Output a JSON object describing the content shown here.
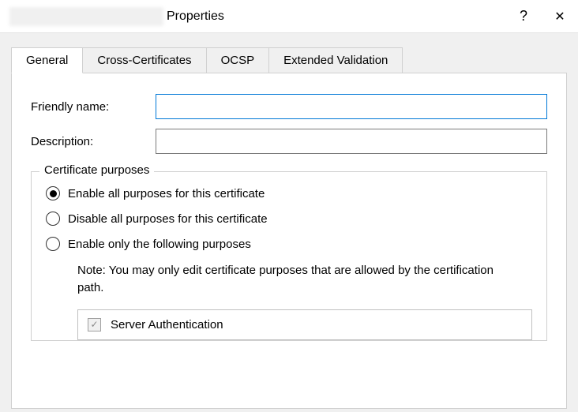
{
  "titlebar": {
    "title": "Properties",
    "help": "?",
    "close": "✕"
  },
  "tabs": [
    {
      "label": "General",
      "active": true
    },
    {
      "label": "Cross-Certificates",
      "active": false
    },
    {
      "label": "OCSP",
      "active": false
    },
    {
      "label": "Extended Validation",
      "active": false
    }
  ],
  "form": {
    "friendly_name_label": "Friendly name:",
    "friendly_name_value": "",
    "description_label": "Description:",
    "description_value": ""
  },
  "fieldset": {
    "legend": "Certificate purposes",
    "radios": [
      {
        "label": "Enable all purposes for this certificate",
        "selected": true
      },
      {
        "label": "Disable all purposes for this certificate",
        "selected": false
      },
      {
        "label": "Enable only the following purposes",
        "selected": false
      }
    ],
    "note": "Note: You may only edit certificate purposes that are allowed by the certification path.",
    "purposes": [
      {
        "label": "Server Authentication",
        "checked": true,
        "disabled": true
      }
    ]
  }
}
